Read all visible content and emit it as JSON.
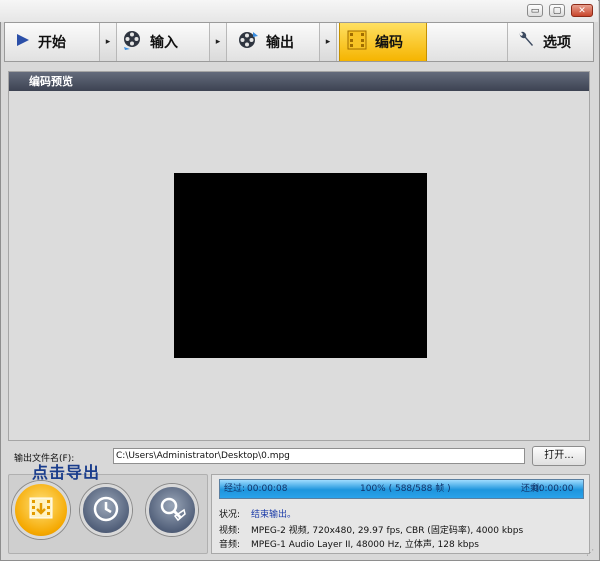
{
  "window_controls": {
    "minimize": "▭",
    "maximize": "▢",
    "close": "✕"
  },
  "toolbar": {
    "items": [
      {
        "label": "开始",
        "icon": "play-icon"
      },
      {
        "label": "输入",
        "icon": "film-reel-input-icon"
      },
      {
        "label": "输出",
        "icon": "film-reel-output-icon"
      },
      {
        "label": "编码",
        "icon": "film-strip-icon",
        "active": true
      },
      {
        "label": "选项",
        "icon": "wrench-icon"
      }
    ],
    "separator_glyph": "▸"
  },
  "preview_panel": {
    "title": "编码预览"
  },
  "output": {
    "label": "输出文件名(F):",
    "value": "C:\\Users\\Administrator\\Desktop\\0.mpg",
    "open_button": "打开..."
  },
  "callout": "点击导出",
  "progress": {
    "elapsed_label": "经过:",
    "elapsed": "00:00:08",
    "percent_text": "100% ( 588/588 帧 )",
    "percent": 100,
    "remaining_label": "还剩:",
    "remaining": "00:00:00"
  },
  "status": {
    "state_label": "状况:",
    "state_value": "结束输出。",
    "video_label": "视频:",
    "video_value": "MPEG-2 视频, 720x480, 29.97 fps, CBR (固定码率), 4000 kbps",
    "audio_label": "音频:",
    "audio_value": "MPEG-1 Audio Layer II, 48000 Hz, 立体声, 128 kbps"
  },
  "colors": {
    "accent_active": "#f5b400",
    "progress_fill": "#1e95dd",
    "header_bg": "#3d4352"
  }
}
